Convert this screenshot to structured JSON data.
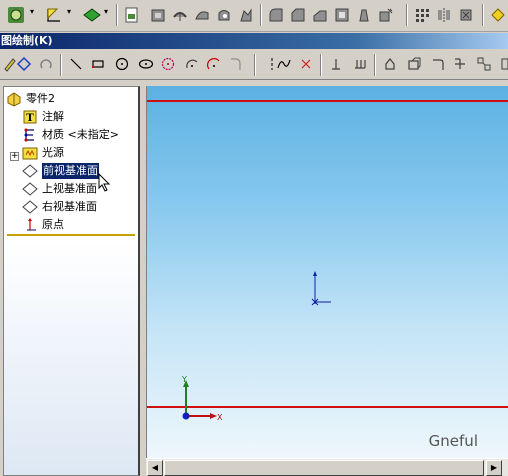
{
  "window": {
    "title": "图绘制(K)"
  },
  "toolbar_top": {
    "icons": [
      "part-dropdown-icon",
      "select-dropdown-icon",
      "view-dropdown-icon",
      "new-document-icon",
      "extrude-icon",
      "revolve-icon",
      "sweep-icon",
      "loft-icon",
      "cut-icon",
      "fillet-icon",
      "chamfer-icon",
      "rib-icon",
      "shell-icon",
      "draft-icon",
      "hole-icon",
      "pattern-icon",
      "mirror-icon",
      "feature-icon",
      "more-icon"
    ]
  },
  "toolbar_sketch": {
    "icons": [
      "sketch-pencil-icon",
      "smart-dimension-icon",
      "rotate-icon",
      "line-icon",
      "rectangle-icon",
      "circle-icon",
      "ellipse-icon",
      "polygon-icon",
      "arc-icon",
      "tangent-arc-icon",
      "centerline-icon",
      "spline-icon",
      "trim-icon",
      "relation-icon",
      "display-relations-icon",
      "offset-icon",
      "convert-icon",
      "mirror-entities-icon",
      "fix-icon"
    ]
  },
  "feature_tree": {
    "root": "零件2",
    "items": [
      {
        "label": "注解",
        "icon": "annotation-icon"
      },
      {
        "label": "材质 <未指定>",
        "icon": "material-icon"
      },
      {
        "label": "光源",
        "icon": "lighting-icon"
      },
      {
        "label": "前视基准面",
        "icon": "plane-icon",
        "selected": true
      },
      {
        "label": "上视基准面",
        "icon": "plane-icon"
      },
      {
        "label": "右视基准面",
        "icon": "plane-icon"
      },
      {
        "label": "原点",
        "icon": "origin-icon"
      }
    ],
    "expander_symbol": "+"
  },
  "viewport": {
    "watermark": "Gneful",
    "triad": {
      "x_label": "X",
      "y_label": "Y"
    },
    "line_color": "#d01010"
  },
  "scrollbar": {
    "left_arrow": "◀",
    "right_arrow": "▶"
  }
}
